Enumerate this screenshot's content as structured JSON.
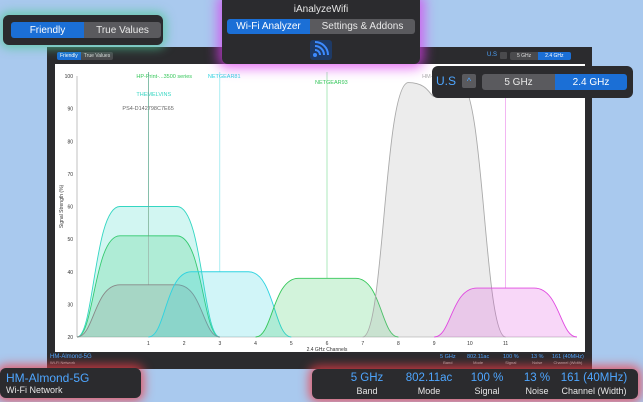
{
  "app_title": "iAnalyzeWifi",
  "tabs": [
    {
      "label": "Wi-Fi Analyzer",
      "active": true
    },
    {
      "label": "Settings & Addons",
      "active": false
    }
  ],
  "view_mode": [
    {
      "label": "Friendly",
      "active": true
    },
    {
      "label": "True Values",
      "active": false
    }
  ],
  "region": {
    "label": "U.S",
    "chevron": "^"
  },
  "band_options": [
    {
      "label": "5 GHz",
      "active": false
    },
    {
      "label": "2.4 GHz",
      "active": true
    }
  ],
  "selected_network": {
    "name": "HM-Almond-5G",
    "label": "Wi-Fi Network"
  },
  "stats": [
    {
      "value": "5 GHz",
      "label": "Band"
    },
    {
      "value": "802.11ac",
      "label": "Mode"
    },
    {
      "value": "100 %",
      "label": "Signal"
    },
    {
      "value": "13 %",
      "label": "Noise"
    },
    {
      "value": "161 (40MHz)",
      "label": "Channel (Width)"
    }
  ],
  "icons": {
    "wifi": "wifi-icon",
    "chevron": "chevron-up-icon"
  },
  "colors": {
    "accent": "#1b6fd6",
    "accent_text": "#4ea6ff",
    "panel": "#2b2b2e",
    "background": "#a9c9ee"
  },
  "chart_data": {
    "type": "area",
    "xlabel": "2.4 GHz Channels",
    "ylabel": "Signal Strength (%)",
    "xlim": [
      -1,
      13
    ],
    "ylim": [
      20,
      100
    ],
    "x_ticks": [
      1,
      2,
      3,
      4,
      5,
      6,
      7,
      8,
      9,
      10,
      11
    ],
    "y_ticks": [
      20,
      30,
      40,
      50,
      60,
      70,
      80,
      90,
      100
    ],
    "grid": false,
    "series": [
      {
        "name": "HP-Print-...3500 series",
        "color": "#34c759",
        "channel": 1,
        "width": 4,
        "peak": 51
      },
      {
        "name": "THEMELVINS",
        "color": "#34d6c2",
        "channel": 1,
        "width": 4,
        "peak": 60
      },
      {
        "name": "PS4-D142798C7E65",
        "color": "#888888",
        "channel": 1,
        "width": 4,
        "peak": 36
      },
      {
        "name": "NETGEAR81",
        "color": "#2fd3e0",
        "channel": 3,
        "width": 4,
        "peak": 40
      },
      {
        "name": "NETGEAR93",
        "color": "#34c759",
        "channel": 6,
        "width": 4,
        "peak": 38
      },
      {
        "name": "HM-",
        "color": "#aaaaaa",
        "channel": 9,
        "width": 4,
        "peak": 98
      },
      {
        "name": "",
        "color": "#e048e0",
        "channel": 11,
        "width": 4,
        "peak": 35
      }
    ]
  },
  "mini": {
    "region": "U.S",
    "network_name": "HM-Almond-5G",
    "network_label": "Wi-Fi Network"
  }
}
